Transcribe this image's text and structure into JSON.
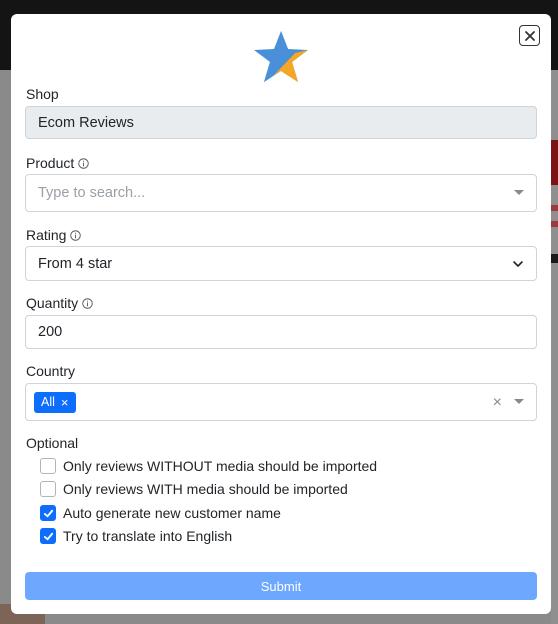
{
  "modal": {
    "close_icon": "close-icon",
    "logo_icon": "star-logo-icon"
  },
  "shop": {
    "label": "Shop",
    "value": "Ecom Reviews"
  },
  "product": {
    "label": "Product",
    "placeholder": "Type to search..."
  },
  "rating": {
    "label": "Rating",
    "selected": "From 4 star"
  },
  "quantity": {
    "label": "Quantity",
    "value": "200"
  },
  "country": {
    "label": "Country",
    "tags": [
      "All"
    ],
    "tag_remove": "×",
    "clear": "×"
  },
  "optional": {
    "label": "Optional",
    "options": [
      {
        "label": "Only reviews WITHOUT media should be imported",
        "checked": false
      },
      {
        "label": "Only reviews WITH media should be imported",
        "checked": false
      },
      {
        "label": "Auto generate new customer name",
        "checked": true
      },
      {
        "label": "Try to translate into English",
        "checked": true
      }
    ]
  },
  "submit": {
    "label": "Submit"
  },
  "colors": {
    "primary": "#0d6efd",
    "submit_disabled": "#6ea8fe",
    "logo_blue": "#4a90d9",
    "logo_yellow": "#f5a623"
  }
}
